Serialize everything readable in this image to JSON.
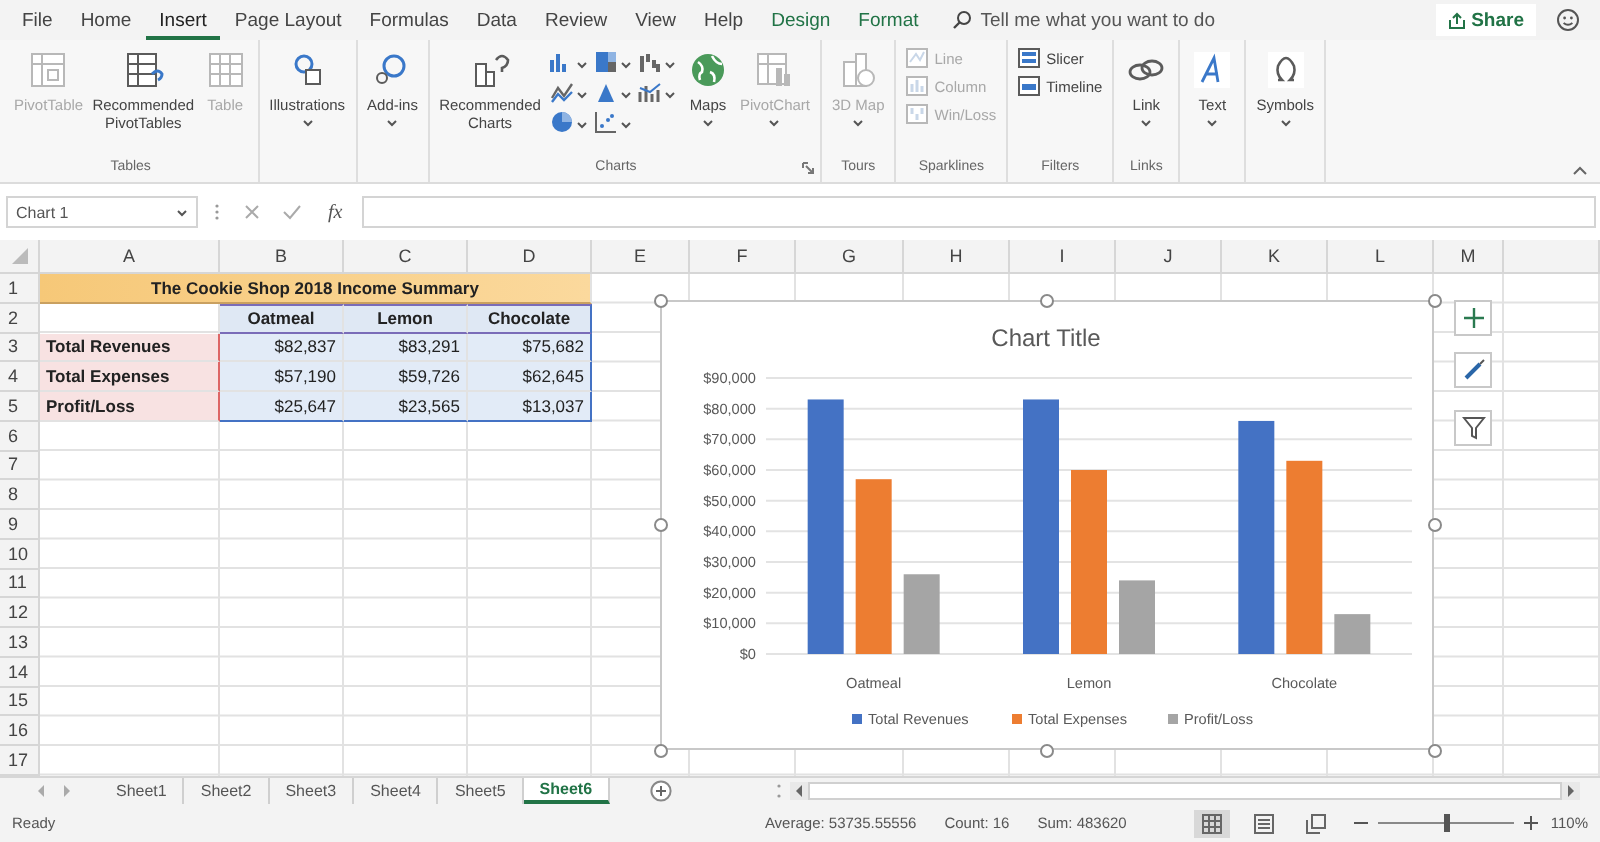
{
  "ribbon_tabs": [
    {
      "label": "File",
      "selected": false,
      "kind": "normal"
    },
    {
      "label": "Home",
      "selected": false,
      "kind": "normal"
    },
    {
      "label": "Insert",
      "selected": true,
      "kind": "normal"
    },
    {
      "label": "Page Layout",
      "selected": false,
      "kind": "normal"
    },
    {
      "label": "Formulas",
      "selected": false,
      "kind": "normal"
    },
    {
      "label": "Data",
      "selected": false,
      "kind": "normal"
    },
    {
      "label": "Review",
      "selected": false,
      "kind": "normal"
    },
    {
      "label": "View",
      "selected": false,
      "kind": "normal"
    },
    {
      "label": "Help",
      "selected": false,
      "kind": "normal"
    },
    {
      "label": "Design",
      "selected": false,
      "kind": "contextual"
    },
    {
      "label": "Format",
      "selected": false,
      "kind": "contextual"
    }
  ],
  "search": {
    "placeholder": "Tell me what you want to do"
  },
  "share_button": {
    "label": "Share"
  },
  "ribbon": {
    "groups": [
      {
        "label": "Tables",
        "launcher": false,
        "items": [
          {
            "kind": "large",
            "label": "PivotTable",
            "disabled": true,
            "dropdown": false
          },
          {
            "kind": "large",
            "label": "Recommended PivotTables",
            "disabled": false,
            "dropdown": false
          },
          {
            "kind": "large",
            "label": "Table",
            "disabled": true,
            "dropdown": false
          }
        ]
      },
      {
        "launcher": false,
        "items": [
          {
            "kind": "large",
            "label": "Illustrations",
            "disabled": false,
            "dropdown": true
          }
        ]
      },
      {
        "launcher": false,
        "items": [
          {
            "kind": "large",
            "label": "Add-ins",
            "disabled": false,
            "dropdown": true
          }
        ]
      },
      {
        "label": "Charts",
        "launcher": true,
        "items": [
          {
            "kind": "large",
            "label": "Recommended Charts",
            "disabled": false,
            "dropdown": false
          },
          {
            "kind": "gallery"
          },
          {
            "kind": "large",
            "label": "Maps",
            "disabled": false,
            "dropdown": true
          },
          {
            "kind": "large",
            "label": "PivotChart",
            "disabled": true,
            "dropdown": true
          }
        ]
      },
      {
        "label": "Tours",
        "launcher": false,
        "items": [
          {
            "kind": "large",
            "label": "3D Map",
            "disabled": true,
            "dropdown": true
          }
        ]
      },
      {
        "label": "Sparklines",
        "launcher": false,
        "items": [
          {
            "kind": "small",
            "label": "Line",
            "disabled": true
          },
          {
            "kind": "small",
            "label": "Column",
            "disabled": true
          },
          {
            "kind": "small",
            "label": "Win/Loss",
            "disabled": true
          }
        ]
      },
      {
        "label": "Filters",
        "launcher": false,
        "items": [
          {
            "kind": "small",
            "label": "Slicer",
            "disabled": false
          },
          {
            "kind": "small",
            "label": "Timeline",
            "disabled": false
          }
        ]
      },
      {
        "label": "Links",
        "launcher": false,
        "items": [
          {
            "kind": "large",
            "label": "Link",
            "disabled": false,
            "dropdown": true
          }
        ]
      },
      {
        "launcher": false,
        "items": [
          {
            "kind": "large",
            "label": "Text",
            "disabled": false,
            "dropdown": true
          }
        ]
      },
      {
        "launcher": false,
        "items": [
          {
            "kind": "large",
            "label": "Symbols",
            "disabled": false,
            "dropdown": true
          }
        ]
      }
    ]
  },
  "formula_bar": {
    "name_box": "Chart 1",
    "function_label": "fx"
  },
  "sheet": {
    "columns": [
      "A",
      "B",
      "C",
      "D",
      "E",
      "F",
      "G",
      "H",
      "I",
      "J",
      "K",
      "L",
      "M"
    ],
    "rows": [
      {
        "number": "1",
        "title": "The Cookie Shop 2018 Income Summary"
      },
      {
        "number": "2",
        "headers": [
          "Oatmeal",
          "Lemon",
          "Chocolate"
        ]
      },
      {
        "number": "3",
        "label": "Total Revenues",
        "values": [
          "$82,837",
          "$83,291",
          "$75,682"
        ]
      },
      {
        "number": "4",
        "label": "Total Expenses",
        "values": [
          "$57,190",
          "$59,726",
          "$62,645"
        ]
      },
      {
        "number": "5",
        "label": "Profit/Loss",
        "values": [
          "$25,647",
          "$23,565",
          "$13,037"
        ]
      },
      {
        "number": "6"
      },
      {
        "number": "7"
      },
      {
        "number": "8"
      },
      {
        "number": "9"
      },
      {
        "number": "10"
      },
      {
        "number": "11"
      },
      {
        "number": "12"
      },
      {
        "number": "13"
      },
      {
        "number": "14"
      },
      {
        "number": "15"
      },
      {
        "number": "16"
      },
      {
        "number": "17"
      }
    ]
  },
  "chart": {
    "chart_data": {
      "type": "bar",
      "title": "Chart Title",
      "categories": [
        "Oatmeal",
        "Lemon",
        "Chocolate"
      ],
      "series": [
        {
          "name": "Total Revenues",
          "color": "#4472c4",
          "values": [
            83000,
            83000,
            76000
          ]
        },
        {
          "name": "Total Expenses",
          "color": "#ed7d31",
          "values": [
            57000,
            60000,
            63000
          ]
        },
        {
          "name": "Profit/Loss",
          "color": "#a5a5a5",
          "values": [
            26000,
            24000,
            13000
          ]
        }
      ],
      "grid": true,
      "legend": "bottom",
      "ylim": [
        0,
        90000
      ],
      "yticks": [
        {
          "value": 0,
          "label": "$0"
        },
        {
          "value": 10000,
          "label": "$10,000"
        },
        {
          "value": 20000,
          "label": "$20,000"
        },
        {
          "value": 30000,
          "label": "$30,000"
        },
        {
          "value": 40000,
          "label": "$40,000"
        },
        {
          "value": 50000,
          "label": "$50,000"
        },
        {
          "value": 60000,
          "label": "$60,000"
        },
        {
          "value": 70000,
          "label": "$70,000"
        },
        {
          "value": 80000,
          "label": "$80,000"
        },
        {
          "value": 90000,
          "label": "$90,000"
        }
      ]
    }
  },
  "sheet_tabs": [
    {
      "label": "Sheet1",
      "selected": false
    },
    {
      "label": "Sheet2",
      "selected": false
    },
    {
      "label": "Sheet3",
      "selected": false
    },
    {
      "label": "Sheet4",
      "selected": false
    },
    {
      "label": "Sheet5",
      "selected": false
    },
    {
      "label": "Sheet6",
      "selected": true
    }
  ],
  "status_bar": {
    "mode": "Ready",
    "average": "Average: 53735.55556",
    "count": "Count: 16",
    "sum": "Sum: 483620",
    "views": [
      {
        "selected": true
      },
      {
        "selected": false
      },
      {
        "selected": false
      }
    ],
    "zoom": {
      "level": 0.5,
      "reading": "110%"
    }
  }
}
